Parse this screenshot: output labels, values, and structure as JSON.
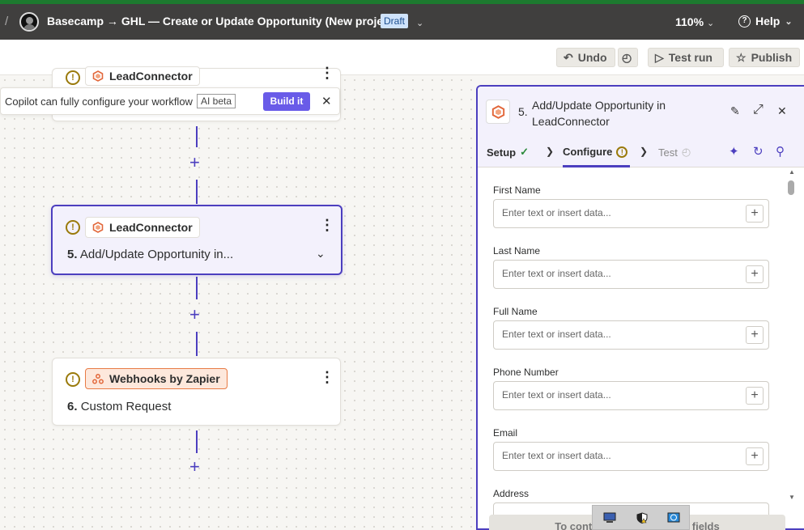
{
  "topbar": {
    "separator": "/",
    "zap_title": "Basecamp → GHL — Create or Update Opportunity (New project)",
    "status_badge": "Draft",
    "zoom": "110%",
    "help": "Help"
  },
  "toolbar": {
    "undo": "Undo",
    "test_run": "Test run",
    "publish": "Publish"
  },
  "copilot": {
    "message": "Copilot can fully configure your workflow",
    "badge": "AI beta",
    "button": "Build it"
  },
  "steps": [
    {
      "app": "LeadConnector",
      "number": "",
      "title": ""
    },
    {
      "app": "LeadConnector",
      "number": "5.",
      "title": "Add/Update Opportunity in..."
    },
    {
      "app": "Webhooks by Zapier",
      "number": "6.",
      "title": "Custom Request"
    }
  ],
  "panel": {
    "number": "5.",
    "title": "Add/Update Opportunity in LeadConnector",
    "tabs": [
      {
        "label": "Setup"
      },
      {
        "label": "Configure"
      },
      {
        "label": "Test"
      }
    ],
    "fields": [
      {
        "label": "First Name",
        "placeholder": "Enter text or insert data..."
      },
      {
        "label": "Last Name",
        "placeholder": "Enter text or insert data..."
      },
      {
        "label": "Full Name",
        "placeholder": "Enter text or insert data..."
      },
      {
        "label": "Phone Number",
        "placeholder": "Enter text or insert data..."
      },
      {
        "label": "Email",
        "placeholder": "Enter text or insert data..."
      },
      {
        "label": "Address",
        "placeholder": ""
      }
    ],
    "bottom_button": "To continue, fill in required fields"
  },
  "colors": {
    "accent": "#4c3fbf",
    "build_button": "#695be8",
    "topbar": "#403f3e",
    "warning": "#9a7a0b",
    "webhook_orange": "#e87b45"
  }
}
